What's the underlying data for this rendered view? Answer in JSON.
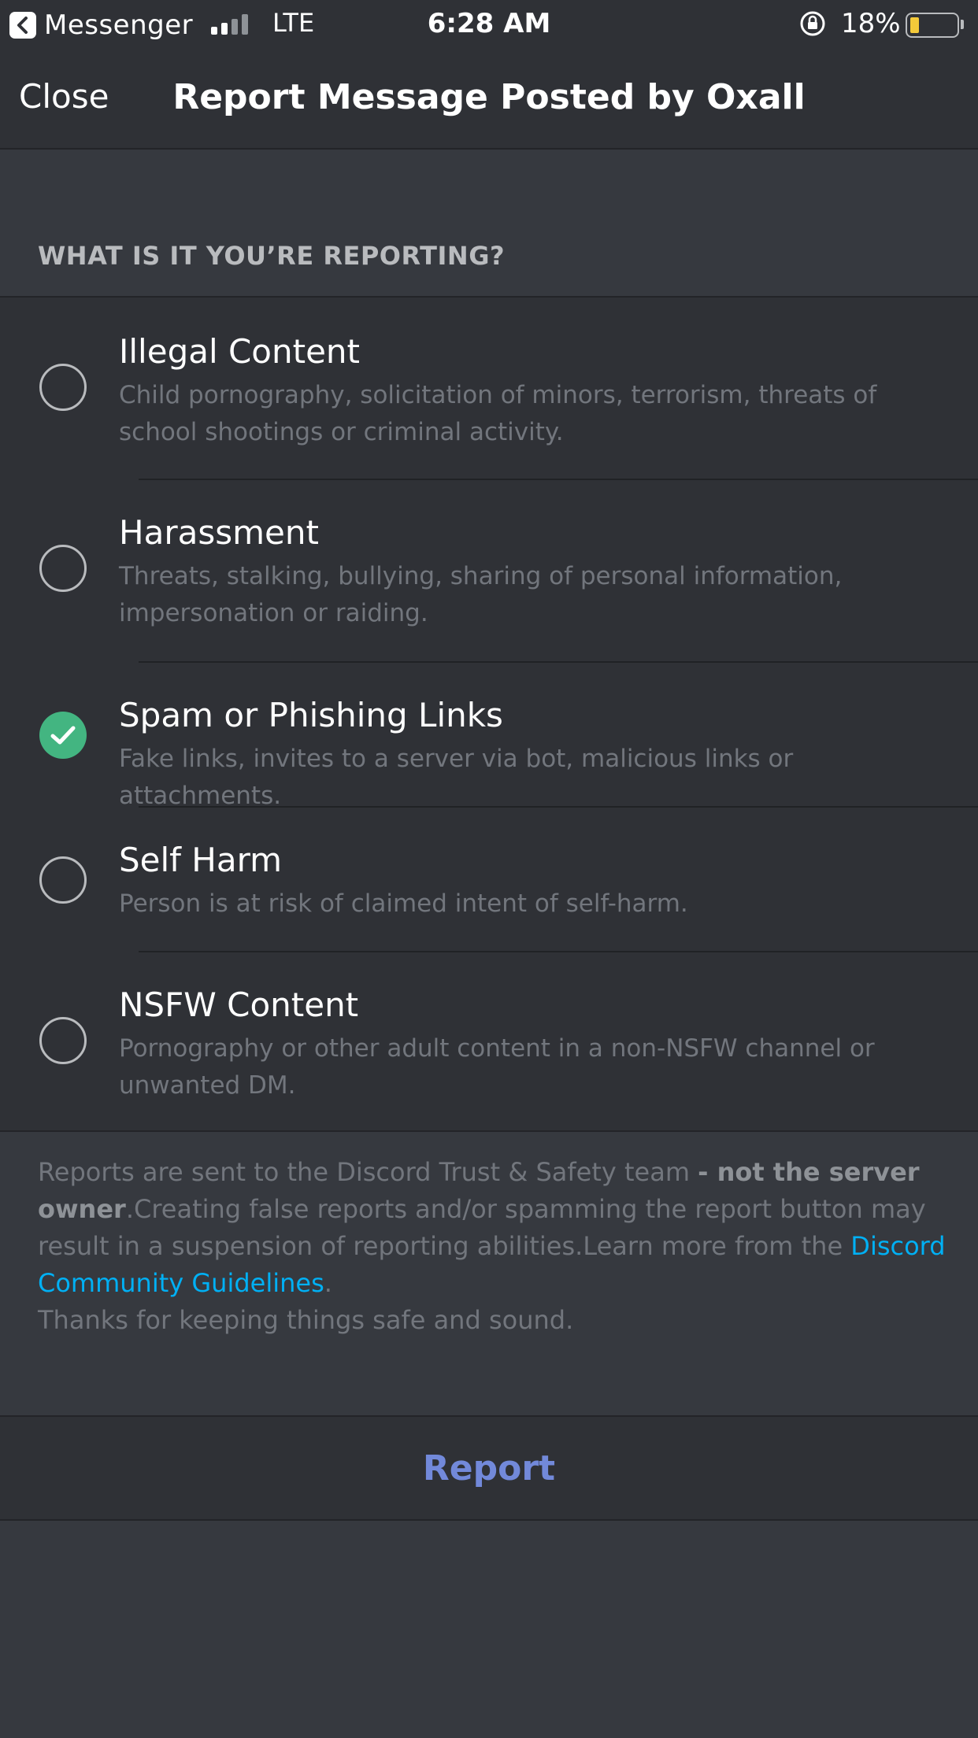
{
  "status_bar": {
    "back_app": "Messenger",
    "network": "LTE",
    "time": "6:28 AM",
    "battery": "18%",
    "battery_level": 0.18,
    "battery_color": "#f3c93a"
  },
  "nav": {
    "close_label": "Close",
    "title": "Report Message Posted by Oxall"
  },
  "section_header": "WHAT IS IT YOU’RE REPORTING?",
  "options": [
    {
      "title": "Illegal Content",
      "desc": "Child pornography, solicitation of minors, terrorism, threats of school shootings or criminal activity.",
      "selected": false
    },
    {
      "title": "Harassment",
      "desc": "Threats, stalking, bullying, sharing of personal information, impersonation or raiding.",
      "selected": false
    },
    {
      "title": "Spam or Phishing Links",
      "desc": "Fake links, invites to a server via bot, malicious links or attachments.",
      "selected": true
    },
    {
      "title": "Self Harm",
      "desc": "Person is at risk of claimed intent of self-harm.",
      "selected": false
    },
    {
      "title": "NSFW Content",
      "desc": "Pornography or other adult content in a non-NSFW channel or unwanted DM.",
      "selected": false
    }
  ],
  "disclaimer": {
    "text_1": "Reports are sent to the Discord Trust & Safety team ",
    "bold": "- not the server owner",
    "text_2": ".Creating false reports and/or spamming the report button may result in a suspension of reporting abilities.Learn more from the ",
    "link": "Discord Community Guidelines",
    "text_3": ".",
    "thanks": "Thanks for keeping things safe and sound."
  },
  "report_label": "Report",
  "colors": {
    "background": "#36393f",
    "surface": "#2f3136",
    "selected": "#43b581",
    "link": "#00b0f4",
    "report": "#7289da"
  }
}
